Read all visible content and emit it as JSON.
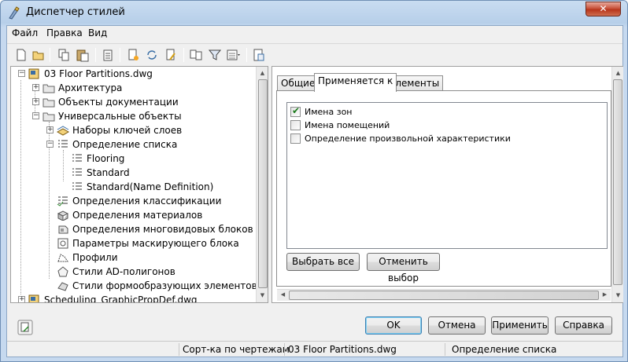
{
  "window": {
    "title": "Диспетчер стилей",
    "close_label": "✕"
  },
  "menu": [
    "Файл",
    "Правка",
    "Вид"
  ],
  "toolbar": [
    {
      "icon": "new-icon"
    },
    {
      "icon": "open-icon"
    },
    {
      "icon": "copy-icon"
    },
    {
      "icon": "paste-icon"
    },
    {
      "icon": "purge-icon"
    },
    {
      "icon": "new-style-icon"
    },
    {
      "icon": "synchronize-icon"
    },
    {
      "icon": "edit-icon"
    },
    {
      "icon": "sort-drawings-icon"
    },
    {
      "icon": "filter-icon"
    },
    {
      "icon": "view-icon"
    },
    {
      "icon": "switch-drawing-icon"
    }
  ],
  "tree": [
    {
      "label": "03 Floor Partitions.dwg",
      "level": 0,
      "expander": "−",
      "icon": "drawing-file-icon"
    },
    {
      "label": "Архитектура",
      "level": 1,
      "expander": "+",
      "icon": "folder-icon"
    },
    {
      "label": "Объекты документации",
      "level": 1,
      "expander": "+",
      "icon": "folder-icon"
    },
    {
      "label": "Универсальные объекты",
      "level": 1,
      "expander": "−",
      "icon": "folder-icon"
    },
    {
      "label": "Наборы ключей слоев",
      "level": 2,
      "expander": "+",
      "icon": "layer-key-icon"
    },
    {
      "label": "Определение списка",
      "level": 2,
      "expander": "−",
      "icon": "list-definition-icon"
    },
    {
      "label": "Flooring",
      "level": 3,
      "expander": "",
      "icon": "list-item-icon"
    },
    {
      "label": "Standard",
      "level": 3,
      "expander": "",
      "icon": "list-item-icon"
    },
    {
      "label": "Standard(Name Definition)",
      "level": 3,
      "expander": "",
      "icon": "list-item-icon"
    },
    {
      "label": "Определения классификации",
      "level": 2,
      "expander": "",
      "icon": "classification-icon"
    },
    {
      "label": "Определения материалов",
      "level": 2,
      "expander": "",
      "icon": "material-icon"
    },
    {
      "label": "Определения многовидовых блоков",
      "level": 2,
      "expander": "",
      "icon": "multiview-block-icon"
    },
    {
      "label": "Параметры маскирующего блока",
      "level": 2,
      "expander": "",
      "icon": "mask-block-icon"
    },
    {
      "label": "Профили",
      "level": 2,
      "expander": "",
      "icon": "profile-icon"
    },
    {
      "label": "Стили AD-полигонов",
      "level": 2,
      "expander": "",
      "icon": "polygon-icon"
    },
    {
      "label": "Стили формообразующих элементов",
      "level": 2,
      "expander": "",
      "icon": "mass-element-icon"
    },
    {
      "label": "Scheduling_GraphicPropDef.dwg",
      "level": 0,
      "expander": "+",
      "icon": "drawing-file-icon"
    }
  ],
  "tabs": [
    "Общие",
    "Применяется к",
    "Элементы"
  ],
  "active_tab": 1,
  "applies_to": [
    {
      "label": "Имена зон",
      "checked": true
    },
    {
      "label": "Имена помещений",
      "checked": false
    },
    {
      "label": "Определение произвольной характеристики",
      "checked": false
    }
  ],
  "buttons": {
    "select_all": "Выбрать все",
    "clear_selection": "Отменить выбор",
    "ok": "OK",
    "cancel": "Отмена",
    "apply": "Применить",
    "help": "Справка"
  },
  "status": {
    "sort": "Сорт-ка по чертежам",
    "drawing": "03 Floor Partitions.dwg",
    "selection": "Определение списка"
  }
}
